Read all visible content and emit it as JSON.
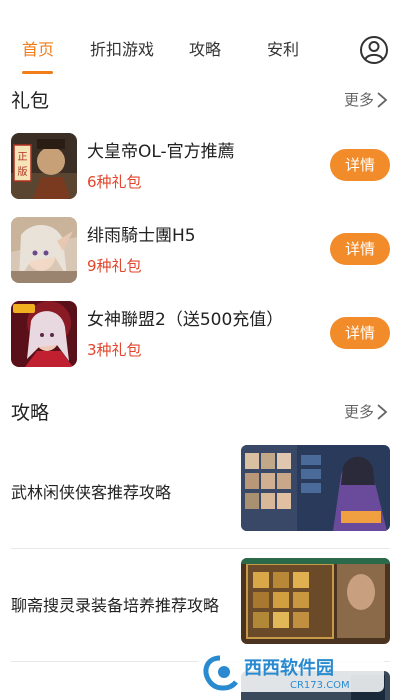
{
  "nav": {
    "tabs": [
      {
        "label": "首页",
        "active": true
      },
      {
        "label": "折扣游戏",
        "active": false
      },
      {
        "label": "攻略",
        "active": false
      },
      {
        "label": "安利",
        "active": false
      }
    ],
    "accent": "#f27d1b",
    "user_icon": "user-icon"
  },
  "gifts": {
    "title": "礼包",
    "more_label": "更多",
    "items": [
      {
        "name": "大皇帝OL-官方推薦",
        "count": "6种礼包",
        "button": "详情"
      },
      {
        "name": "绯雨騎士團H5",
        "count": "9种礼包",
        "button": "详情"
      },
      {
        "name": "女神聯盟2（送500充值）",
        "count": "3种礼包",
        "button": "详情"
      }
    ]
  },
  "guides": {
    "title": "攻略",
    "more_label": "更多",
    "items": [
      {
        "title": "武林闲侠侠客推荐攻略"
      },
      {
        "title": "聊斋搜灵录装备培养推荐攻略"
      }
    ]
  },
  "watermark": {
    "brand": "西西软件园",
    "url": "CR173.COM"
  },
  "colors": {
    "button": "#f28c2a",
    "count_red": "#e2452c"
  }
}
